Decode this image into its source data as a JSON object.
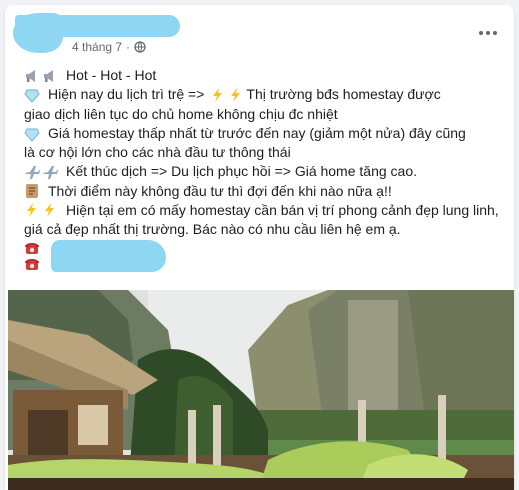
{
  "post": {
    "date": "4 tháng 7",
    "separator": "·",
    "lines": [
      "Hot - Hot - Hot",
      "Hiện nay du lịch trì trệ  =>",
      "Thị trường bđs homestay được",
      "giao dịch liên tục do chủ home không chịu đc nhiệt",
      "Giá homestay thấp nhất từ trước đến nay (giảm một nửa) đây cũng",
      "là cơ hội lớn cho các nhà đầu tư thông thái",
      "Kết thúc dịch => Du lịch phục hồi => Giá home tăng cao.",
      "Thời điểm này không đầu tư thì đợi đến khi nào nữa ạ!!",
      "Hiện tại em có mấy homestay cần bán vị trí phong cảnh đẹp lung linh, giá cả đẹp nhất thị trường. Bác nào có nhu cầu liên hệ em ạ."
    ]
  },
  "icons": {
    "megaphone": "megaphone-icon",
    "diamond": "diamond-icon",
    "lightning": "lightning-icon",
    "airplane": "airplane-icon",
    "scroll": "scroll-icon",
    "phone": "telephone-icon",
    "globe": "globe-icon",
    "more": "more-options-icon"
  },
  "colors": {
    "redaction": "#8fd6f2",
    "meta_text": "#65676b",
    "body_text": "#1c1e21"
  }
}
